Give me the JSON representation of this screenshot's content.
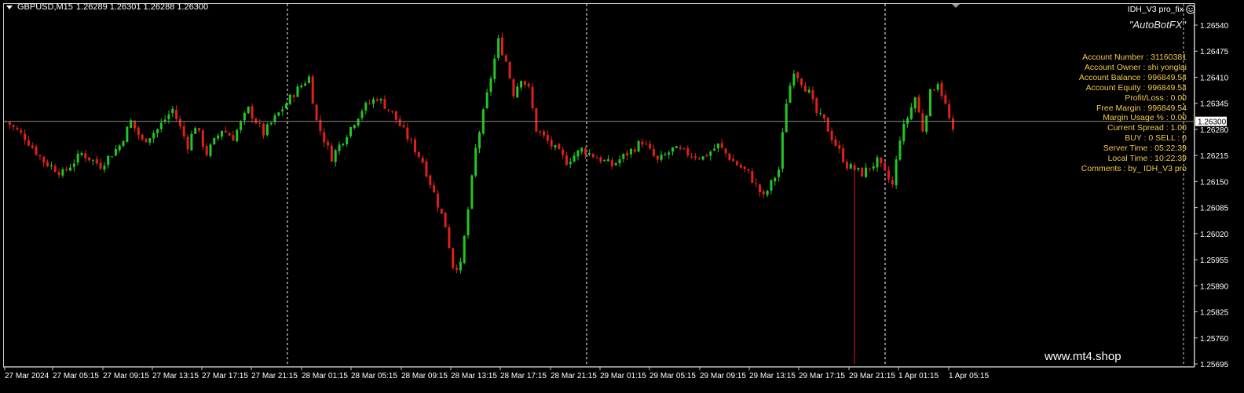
{
  "header": {
    "symbol": "GBPUSD,M15",
    "ohlc": "1.26289 1.26301 1.26288 1.26300"
  },
  "expert": {
    "name": "IDH_V3 pro_fix",
    "brand": "\"AutoBotFX\""
  },
  "account_info": [
    "Account Number : 31160381",
    "Account Owner : shi yonglai",
    "Account Balance : 996849.54",
    "Account Equity : 996849.54",
    "Profit/Loss : 0.00",
    "Free Margin : 996849.54",
    "Margin Usage % : 0.00",
    "Current Spread : 1.00",
    "BUY : 0 SELL : 0",
    "Server Time : 05:22:39",
    "Local Time : 10:22:39",
    "Comments : by_ IDH_V3 pro"
  ],
  "watermark": "www.mt4.shop",
  "colors": {
    "background": "#000000",
    "bull_candle": "#22c722",
    "bear_candle": "#e0201a",
    "grid_separator": "#ffffff",
    "bid_line": "#8a8a8a",
    "axis_text": "#ffffff",
    "info_text": "#f2c94c"
  },
  "chart_data": {
    "type": "candlestick",
    "symbol": "GBPUSD",
    "timeframe": "M15",
    "current_price": "1.26300",
    "y_axis": {
      "range": [
        1.25665,
        1.26595
      ],
      "ticks": [
        "1.26540",
        "1.26475",
        "1.26410",
        "1.26345",
        "1.26280",
        "1.26215",
        "1.26150",
        "1.26085",
        "1.26020",
        "1.25955",
        "1.25890",
        "1.25825",
        "1.25760",
        "1.25695"
      ]
    },
    "x_axis": {
      "ticks": [
        "27 Mar 2024",
        "27 Mar 05:15",
        "27 Mar 09:15",
        "27 Mar 13:15",
        "27 Mar 17:15",
        "27 Mar 21:15",
        "28 Mar 01:15",
        "28 Mar 05:15",
        "28 Mar 09:15",
        "28 Mar 13:15",
        "28 Mar 17:15",
        "28 Mar 21:15",
        "29 Mar 01:15",
        "29 Mar 05:15",
        "29 Mar 09:15",
        "29 Mar 13:15",
        "29 Mar 17:15",
        "29 Mar 21:15",
        "1 Apr 01:15",
        "1 Apr 05:15"
      ]
    },
    "close_path": [
      [
        0,
        1.263
      ],
      [
        5,
        1.2626
      ],
      [
        10,
        1.262
      ],
      [
        15,
        1.2617
      ],
      [
        20,
        1.2622
      ],
      [
        25,
        1.2619
      ],
      [
        30,
        1.2624
      ],
      [
        33,
        1.263
      ],
      [
        36,
        1.2625
      ],
      [
        40,
        1.2628
      ],
      [
        44,
        1.2633
      ],
      [
        48,
        1.2624
      ],
      [
        50,
        1.2629
      ],
      [
        53,
        1.2622
      ],
      [
        57,
        1.2628
      ],
      [
        60,
        1.2626
      ],
      [
        64,
        1.2633
      ],
      [
        68,
        1.2627
      ],
      [
        72,
        1.2632
      ],
      [
        76,
        1.2637
      ],
      [
        80,
        1.2641
      ],
      [
        82,
        1.263
      ],
      [
        86,
        1.2621
      ],
      [
        90,
        1.2627
      ],
      [
        94,
        1.2633
      ],
      [
        98,
        1.2636
      ],
      [
        102,
        1.2632
      ],
      [
        106,
        1.2626
      ],
      [
        110,
        1.262
      ],
      [
        113,
        1.2612
      ],
      [
        116,
        1.2604
      ],
      [
        118,
        1.2594
      ],
      [
        120,
        1.2594
      ],
      [
        122,
        1.2608
      ],
      [
        124,
        1.2623
      ],
      [
        126,
        1.2632
      ],
      [
        128,
        1.2641
      ],
      [
        130,
        1.265
      ],
      [
        132,
        1.2645
      ],
      [
        134,
        1.2637
      ],
      [
        136,
        1.2641
      ],
      [
        138,
        1.2638
      ],
      [
        140,
        1.2628
      ],
      [
        144,
        1.2624
      ],
      [
        148,
        1.262
      ],
      [
        152,
        1.2623
      ],
      [
        156,
        1.2621
      ],
      [
        160,
        1.2619
      ],
      [
        164,
        1.2622
      ],
      [
        168,
        1.2625
      ],
      [
        172,
        1.262
      ],
      [
        176,
        1.2623
      ],
      [
        180,
        1.2622
      ],
      [
        184,
        1.2621
      ],
      [
        188,
        1.2624
      ],
      [
        192,
        1.262
      ],
      [
        196,
        1.2617
      ],
      [
        200,
        1.2611
      ],
      [
        204,
        1.2618
      ],
      [
        206,
        1.2635
      ],
      [
        208,
        1.2643
      ],
      [
        210,
        1.264
      ],
      [
        212,
        1.2637
      ],
      [
        214,
        1.2632
      ],
      [
        216,
        1.263
      ],
      [
        218,
        1.2626
      ],
      [
        222,
        1.2619
      ],
      [
        226,
        1.2617
      ],
      [
        230,
        1.262
      ],
      [
        234,
        1.2614
      ],
      [
        236,
        1.2626
      ],
      [
        238,
        1.2631
      ],
      [
        240,
        1.2636
      ],
      [
        242,
        1.2628
      ],
      [
        244,
        1.2637
      ],
      [
        246,
        1.264
      ],
      [
        248,
        1.2634
      ],
      [
        250,
        1.2627
      ]
    ]
  }
}
